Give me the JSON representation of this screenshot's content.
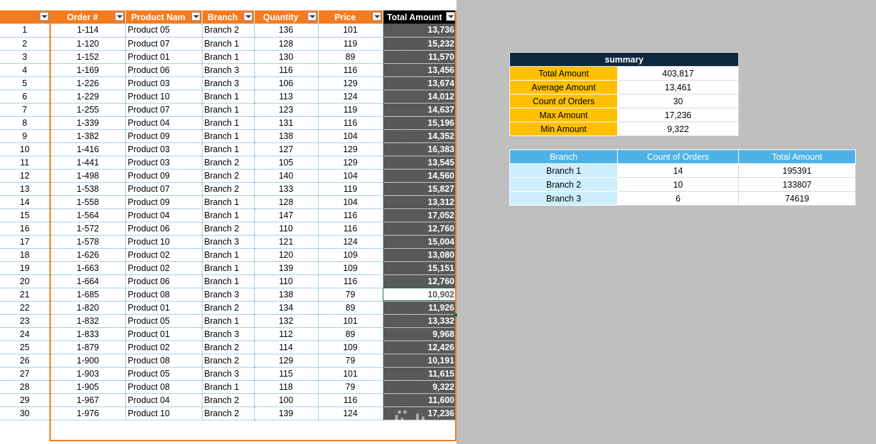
{
  "colors": {
    "header_orange": "#f47c20",
    "total_dark": "#595959",
    "summary_navy": "#0e2841",
    "summary_gold": "#ffc000",
    "branch_blue": "#4db3e6",
    "branch_light": "#cdeefb"
  },
  "main_table": {
    "headers": [
      "",
      "Order #",
      "Product Nam",
      "Branch",
      "Quantity",
      "Price",
      "Total Amount"
    ],
    "rows": [
      [
        "1",
        "1-114",
        "Product 05",
        "Branch 2",
        "136",
        "101",
        "13,736"
      ],
      [
        "2",
        "1-120",
        "Product 07",
        "Branch 1",
        "128",
        "119",
        "15,232"
      ],
      [
        "3",
        "1-152",
        "Product 01",
        "Branch 1",
        "130",
        "89",
        "11,570"
      ],
      [
        "4",
        "1-169",
        "Product 06",
        "Branch 3",
        "116",
        "116",
        "13,456"
      ],
      [
        "5",
        "1-226",
        "Product 03",
        "Branch 3",
        "106",
        "129",
        "13,674"
      ],
      [
        "6",
        "1-229",
        "Product 10",
        "Branch 1",
        "113",
        "124",
        "14,012"
      ],
      [
        "7",
        "1-255",
        "Product 07",
        "Branch 1",
        "123",
        "119",
        "14,637"
      ],
      [
        "8",
        "1-339",
        "Product 04",
        "Branch 1",
        "131",
        "116",
        "15,196"
      ],
      [
        "9",
        "1-382",
        "Product 09",
        "Branch 1",
        "138",
        "104",
        "14,352"
      ],
      [
        "10",
        "1-416",
        "Product 03",
        "Branch 1",
        "127",
        "129",
        "16,383"
      ],
      [
        "11",
        "1-441",
        "Product 03",
        "Branch 2",
        "105",
        "129",
        "13,545"
      ],
      [
        "12",
        "1-498",
        "Product 09",
        "Branch 2",
        "140",
        "104",
        "14,560"
      ],
      [
        "13",
        "1-538",
        "Product 07",
        "Branch 2",
        "133",
        "119",
        "15,827"
      ],
      [
        "14",
        "1-558",
        "Product 09",
        "Branch 1",
        "128",
        "104",
        "13,312"
      ],
      [
        "15",
        "1-564",
        "Product 04",
        "Branch 1",
        "147",
        "116",
        "17,052"
      ],
      [
        "16",
        "1-572",
        "Product 06",
        "Branch 2",
        "110",
        "116",
        "12,760"
      ],
      [
        "17",
        "1-578",
        "Product 10",
        "Branch 3",
        "121",
        "124",
        "15,004"
      ],
      [
        "18",
        "1-626",
        "Product 02",
        "Branch 1",
        "120",
        "109",
        "13,080"
      ],
      [
        "19",
        "1-663",
        "Product 02",
        "Branch 1",
        "139",
        "109",
        "15,151"
      ],
      [
        "20",
        "1-664",
        "Product 06",
        "Branch 1",
        "110",
        "116",
        "12,760"
      ],
      [
        "21",
        "1-685",
        "Product 08",
        "Branch 3",
        "138",
        "79",
        "10,902"
      ],
      [
        "22",
        "1-820",
        "Product 01",
        "Branch 2",
        "134",
        "89",
        "11,926"
      ],
      [
        "23",
        "1-832",
        "Product 05",
        "Branch 1",
        "132",
        "101",
        "13,332"
      ],
      [
        "24",
        "1-833",
        "Product 01",
        "Branch 3",
        "112",
        "89",
        "9,968"
      ],
      [
        "25",
        "1-879",
        "Product 02",
        "Branch 2",
        "114",
        "109",
        "12,426"
      ],
      [
        "26",
        "1-900",
        "Product 08",
        "Branch 2",
        "129",
        "79",
        "10,191"
      ],
      [
        "27",
        "1-903",
        "Product 05",
        "Branch 3",
        "115",
        "101",
        "11,615"
      ],
      [
        "28",
        "1-905",
        "Product 08",
        "Branch 1",
        "118",
        "79",
        "9,322"
      ],
      [
        "29",
        "1-967",
        "Product 04",
        "Branch 2",
        "100",
        "116",
        "11,600"
      ],
      [
        "30",
        "1-976",
        "Product 10",
        "Branch 2",
        "139",
        "124",
        "17,236"
      ]
    ],
    "selected_row": 21
  },
  "summary": {
    "title": "summary",
    "rows": [
      {
        "label": "Total Amount",
        "value": "403,817"
      },
      {
        "label": "Average Amount",
        "value": "13,461"
      },
      {
        "label": "Count of Orders",
        "value": "30"
      },
      {
        "label": "Max Amount",
        "value": "17,236"
      },
      {
        "label": "Min Amount",
        "value": "9,322"
      }
    ]
  },
  "branch_summary": {
    "headers": [
      "Branch",
      "Count of Orders",
      "Total Amount"
    ],
    "rows": [
      [
        "Branch 1",
        "14",
        "195391"
      ],
      [
        "Branch 2",
        "10",
        "133807"
      ],
      [
        "Branch 3",
        "6",
        "74619"
      ]
    ]
  }
}
